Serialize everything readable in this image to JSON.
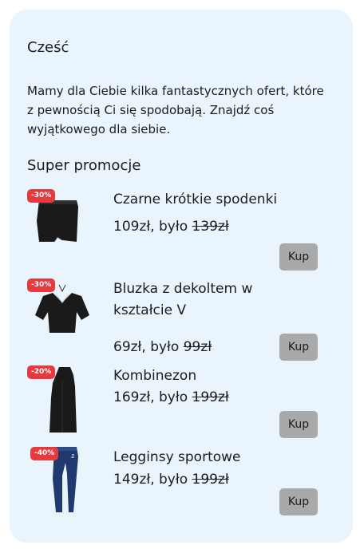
{
  "greeting": "Cześć",
  "intro": "Mamy dla Ciebie kilka fantastycznych ofert, które z pewnością Ci się spodobają. Znajdź coś wyjątkowego dla siebie.",
  "section_title": "Super promocje",
  "price_separator": ", było ",
  "products": [
    {
      "name": "Czarne krótkie spodenki",
      "discount": "-30%",
      "price": "109zł",
      "old_price": "139zł",
      "buy_label": "Kup",
      "image": "black-skort-image"
    },
    {
      "name": "Bluzka z dekoltem w kształcie V",
      "discount": "-30%",
      "price": "69zł",
      "old_price": "99zł",
      "buy_label": "Kup",
      "image": "v-neck-blouse-image"
    },
    {
      "name": "Kombinezon",
      "discount": "-20%",
      "price": "169zł",
      "old_price": "199zł",
      "buy_label": "Kup",
      "image": "black-jumpsuit-image"
    },
    {
      "name": "Legginsy sportowe",
      "discount": "-40%",
      "price": "149zł",
      "old_price": "199zł",
      "buy_label": "Kup",
      "image": "navy-leggings-image"
    }
  ],
  "colors": {
    "card_bg": "#eaf4fd",
    "badge": "#e63a3e",
    "button": "#a9a9a9",
    "text": "#1c1c1c"
  }
}
